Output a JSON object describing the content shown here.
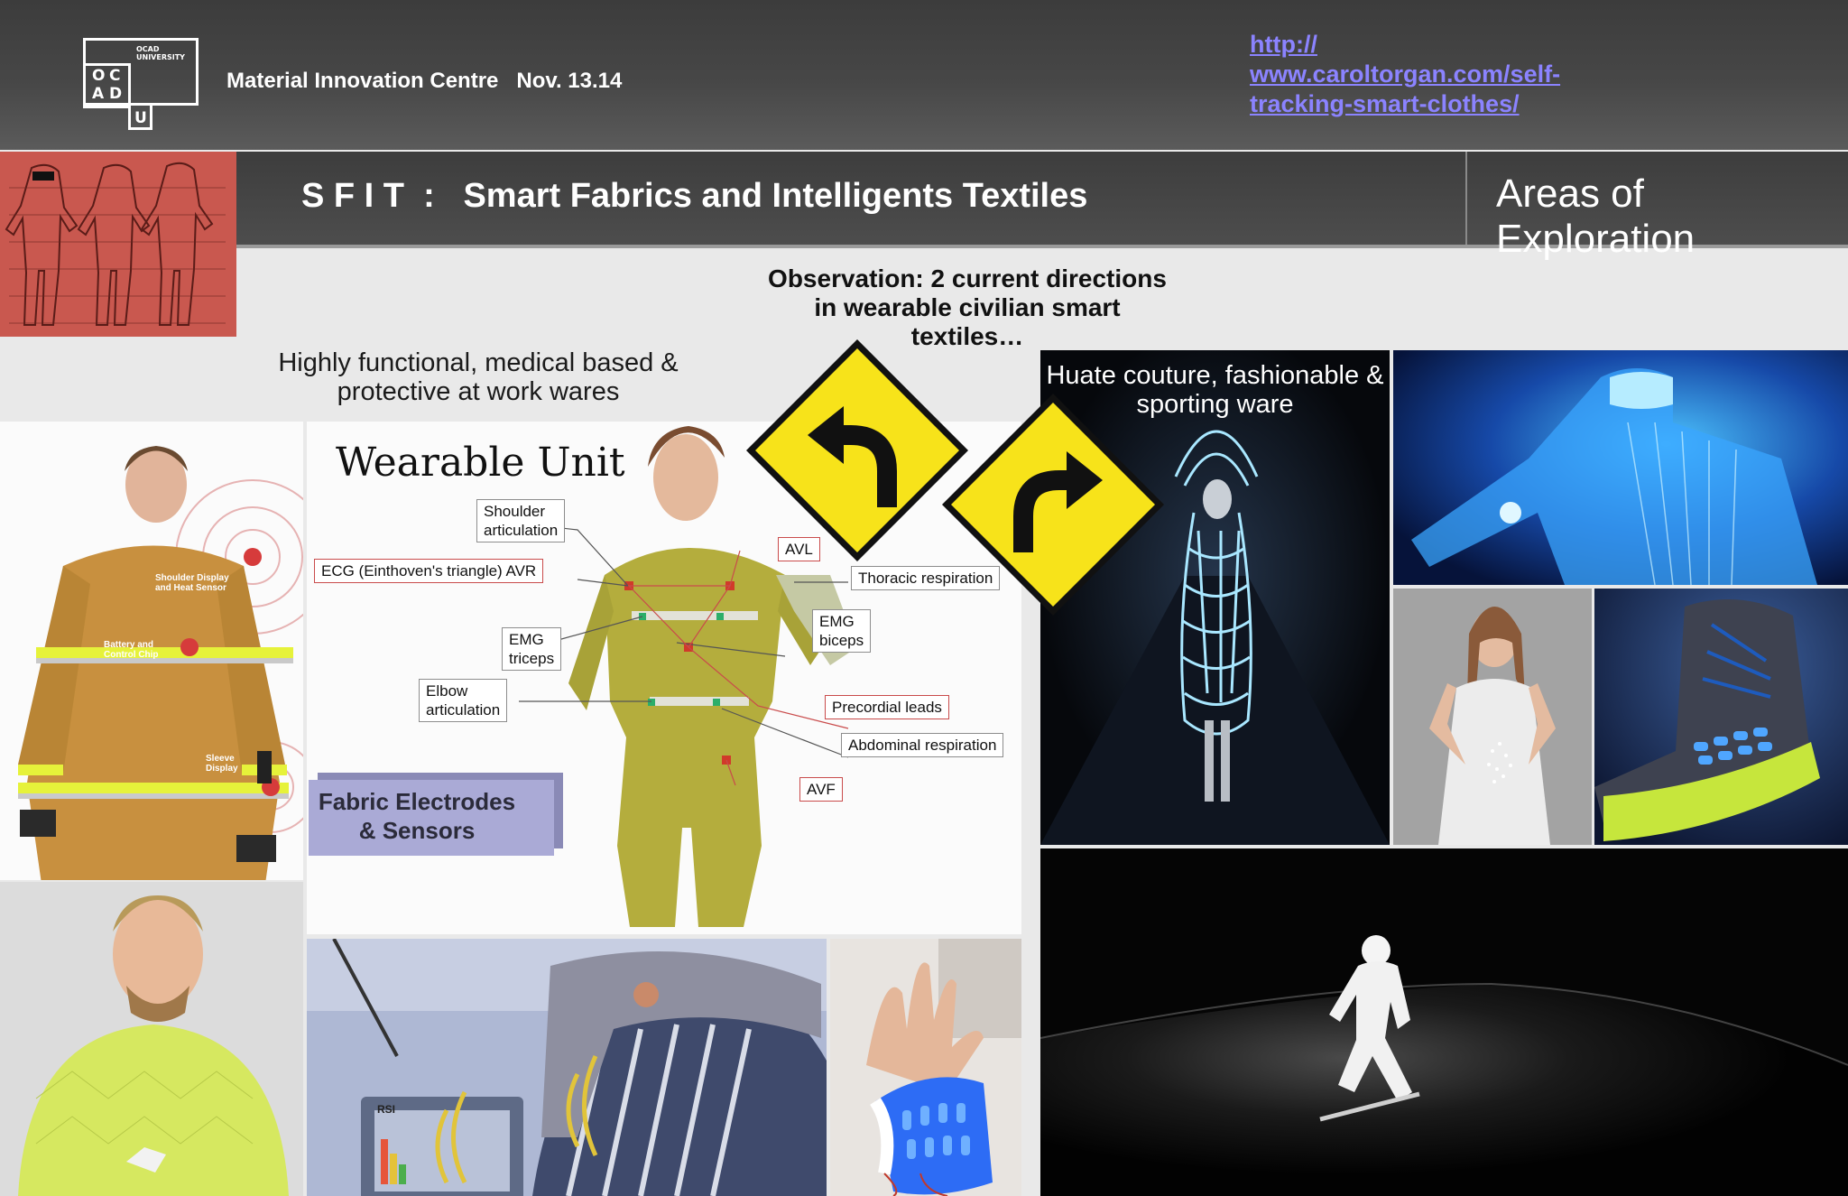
{
  "header": {
    "logo": {
      "letters": [
        "O",
        "C",
        "A",
        "D",
        "U"
      ],
      "university_text": "OCAD\nUNIVERSITY"
    },
    "venue": "Material Innovation Centre   Nov. 13.14",
    "link_text": "http://\nwww.caroltorgan.com/self-tracking-smart-clothes/"
  },
  "title_bar": {
    "title": "S F I T  :   Smart Fabrics and Intelligents Textiles",
    "section": "Areas of Exploration"
  },
  "observation": "Observation: 2 current directions\nin wearable civilian smart\ntextiles…",
  "left_caption": "Highly functional, medical based &\nprotective at work wares",
  "right_caption": "Huate couture, fashionable &\nsporting ware",
  "diagram": {
    "title": "Wearable Unit",
    "labels": {
      "shoulder": "Shoulder\narticulation",
      "ecg": "ECG (Einthoven's triangle) AVR",
      "avl": "AVL",
      "thoracic": "Thoracic respiration",
      "emg_triceps": "EMG\ntriceps",
      "emg_biceps": "EMG\nbiceps",
      "elbow": "Elbow\narticulation",
      "precordial": "Precordial leads",
      "abdominal": "Abdominal respiration",
      "avf": "AVF"
    },
    "badge": "Fabric Electrodes\n& Sensors"
  },
  "firefighter_labels": {
    "shoulder": "Shoulder Display\nand Heat Sensor",
    "battery": "Battery and\nControl Chip",
    "sleeve": "Sleeve\nDisplay"
  },
  "rsi_screen_label": "RSI",
  "colors": {
    "link": "#8b83ff",
    "header_bg": "#474747",
    "sign_yellow": "#f7e31a",
    "diagram_label_red": "#c94b4b"
  }
}
